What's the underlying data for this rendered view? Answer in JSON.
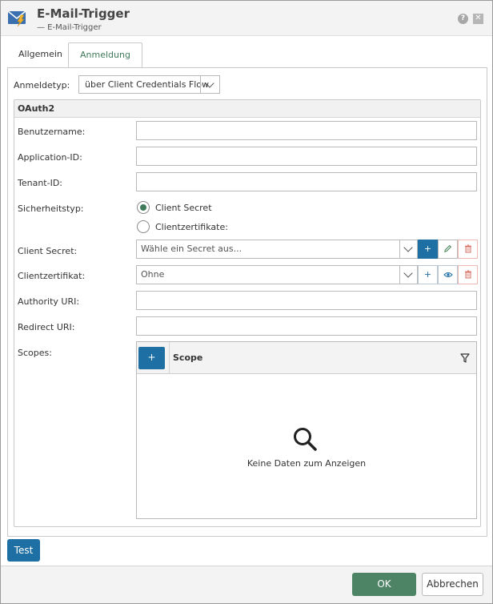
{
  "window": {
    "title": "E-Mail-Trigger",
    "subtitle": "— E-Mail-Trigger",
    "help_glyph": "?",
    "close_glyph": "✕"
  },
  "tabs": [
    {
      "label": "Allgemein",
      "active": false
    },
    {
      "label": "Anmeldung",
      "active": true
    }
  ],
  "login_type": {
    "label": "Anmeldetyp:",
    "value": "über Client Credentials Flow"
  },
  "oauth": {
    "group_title": "OAuth2",
    "username_label": "Benutzername:",
    "username_value": "",
    "app_id_label": "Application-ID:",
    "app_id_value": "",
    "tenant_id_label": "Tenant-ID:",
    "tenant_id_value": "",
    "security_type_label": "Sicherheitstyp:",
    "security_options": [
      {
        "label": "Client Secret",
        "checked": true
      },
      {
        "label": "Clientzertifikate:",
        "checked": false
      }
    ],
    "client_secret_label": "Client Secret:",
    "client_secret_placeholder": "Wähle ein Secret aus...",
    "client_cert_label": "Clientzertifikat:",
    "client_cert_value": "Ohne",
    "authority_uri_label": "Authority URI:",
    "authority_uri_value": "",
    "redirect_uri_label": "Redirect URI:",
    "redirect_uri_value": "",
    "scopes_label": "Scopes:",
    "scopes_grid": {
      "add_glyph": "+",
      "column": "Scope",
      "empty_text": "Keine Daten zum Anzeigen"
    }
  },
  "buttons": {
    "add_glyph": "+",
    "test": "Test",
    "ok": "OK",
    "cancel": "Abbrechen"
  },
  "colors": {
    "accent_blue": "#1e6fa3",
    "accent_green": "#4e8466",
    "delete_red": "#d96c60"
  }
}
